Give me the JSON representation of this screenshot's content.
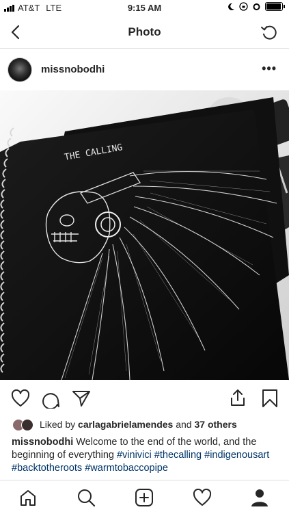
{
  "status_bar": {
    "carrier": "AT&T",
    "network": "LTE",
    "time": "9:15 AM"
  },
  "header": {
    "title": "Photo"
  },
  "post": {
    "username": "missnobodhi",
    "more_label": "•••",
    "drawing_text": "THE CALLING",
    "liked_by_prefix": "Liked by ",
    "liked_by_user": "carlagabrielamendes",
    "liked_by_and": " and ",
    "liked_by_others": "37 others",
    "caption_user": "missnobodhi",
    "caption_text": " Welcome to the end of the world, and the beginning of everything ",
    "hashtags": [
      "#vinivici",
      "#thecalling",
      "#indigenousart",
      "#backtotheroots",
      "#warmtobaccopipe"
    ]
  },
  "icons": {
    "back": "chevron-left-icon",
    "refresh": "refresh-icon",
    "like": "heart-icon",
    "comment": "comment-icon",
    "share": "paper-plane-icon",
    "upload": "upload-icon",
    "save": "bookmark-icon",
    "home": "home-icon",
    "search": "search-icon",
    "add": "add-post-icon",
    "activity": "heart-icon",
    "profile": "profile-icon"
  },
  "colors": {
    "hashtag": "#003569",
    "divider": "#dbdbdb",
    "text": "#262626"
  }
}
